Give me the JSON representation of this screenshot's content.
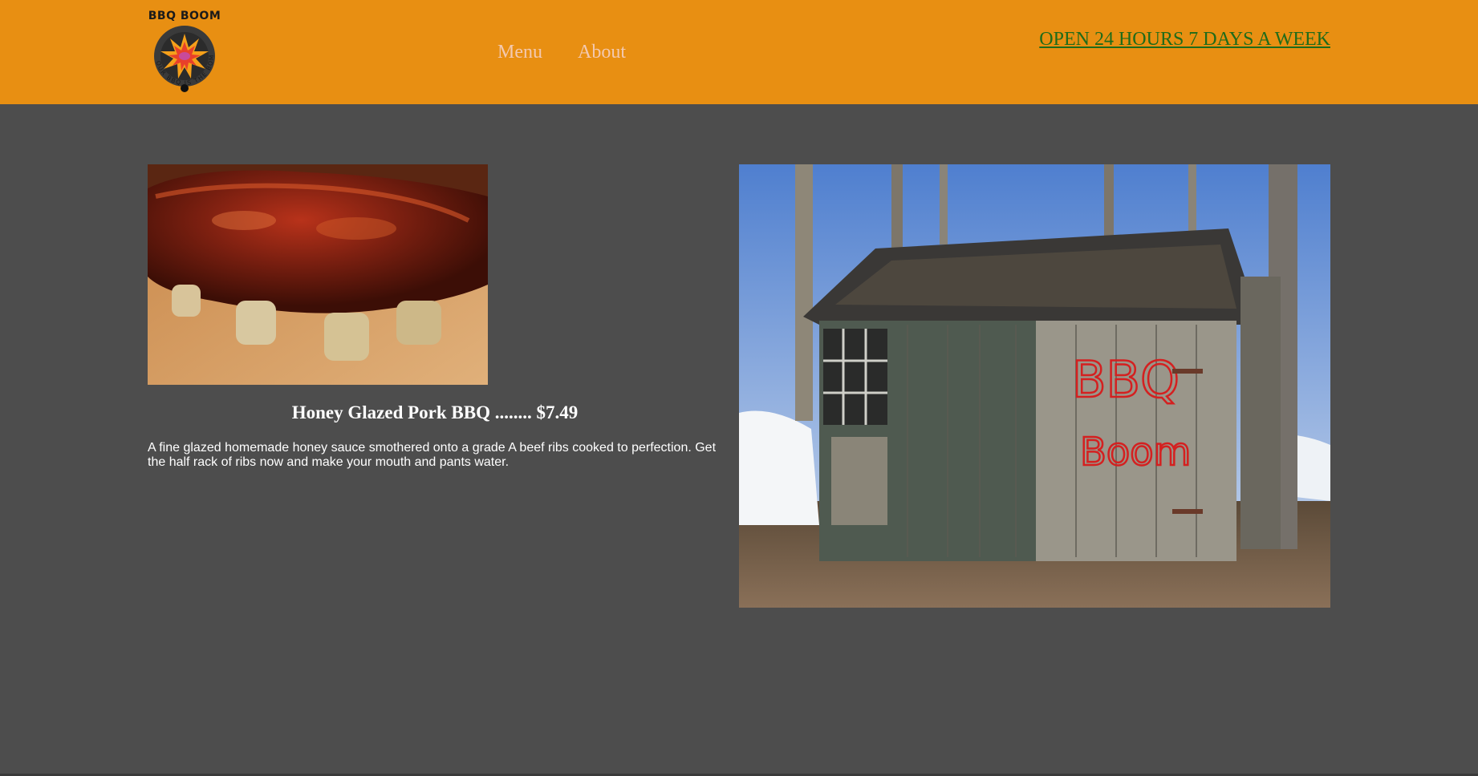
{
  "header": {
    "logo": {
      "title": "BBQ BOOM",
      "ring_text": "OUR BBQ IS THE BOMB"
    },
    "nav": {
      "menu_label": "Menu",
      "about_label": "About"
    },
    "hours_label": "OPEN 24 HOURS 7 DAYS A WEEK"
  },
  "main": {
    "dish": {
      "title": "Honey Glazed Pork BBQ ........ $7.49",
      "description": "A fine glazed homemade honey sauce smothered onto a grade A beef ribs cooked to perfection. Get the half rack of ribs now and make your mouth and pants water."
    },
    "shed_sign": {
      "line1": "BBQ",
      "line2": "Boom"
    }
  },
  "colors": {
    "header_bg": "#e88f12",
    "page_bg": "#4d4d4d",
    "nav_text": "#f3c9b0",
    "hours_link": "#1f6b1a",
    "sign_red": "#d42020"
  },
  "icons": {
    "logo": "explosion-bomb-logo",
    "food_photo": "bbq-ribs-photo",
    "shed_photo": "wooden-shed-photo"
  }
}
